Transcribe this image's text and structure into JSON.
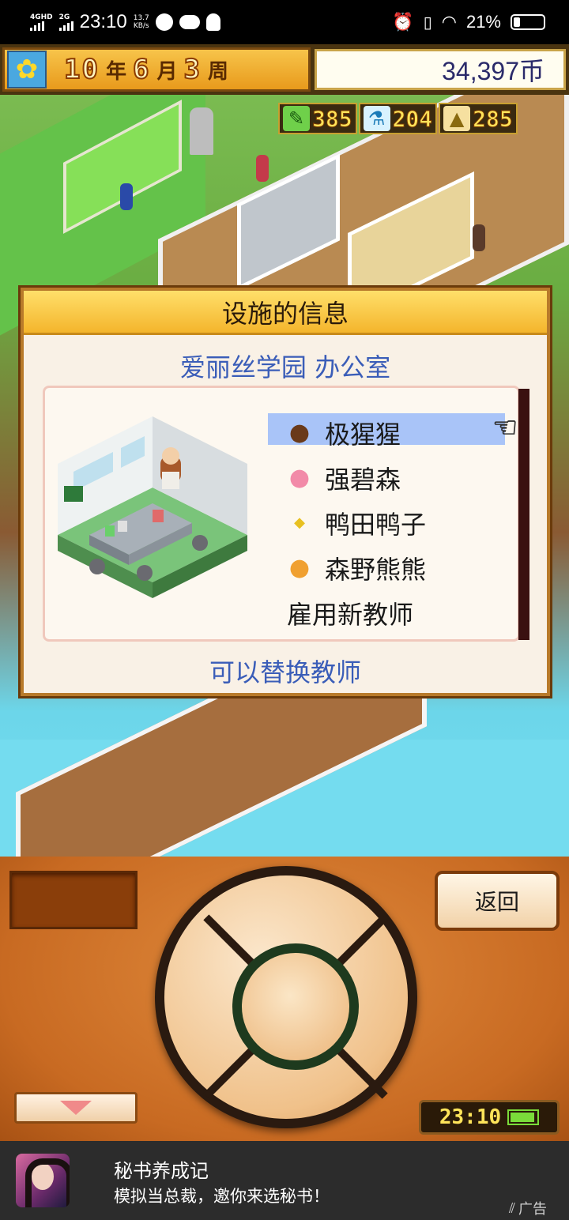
{
  "status_bar": {
    "network_1": "4GHD",
    "network_2": "2G",
    "time": "23:10",
    "speed_value": "13.7",
    "speed_unit": "KB/s",
    "battery_percent": "21%"
  },
  "hud": {
    "year": "10",
    "year_unit": "年",
    "month": "6",
    "month_unit": "月",
    "week": "3",
    "week_unit": "周",
    "money": "34,397币",
    "stats": [
      {
        "icon": "pencil-icon",
        "value": "385",
        "color": "#6fd04a"
      },
      {
        "icon": "flask-icon",
        "value": "204",
        "color": "#4ac3e8"
      },
      {
        "icon": "pyramid-icon",
        "value": "285",
        "color": "#e8c04a"
      }
    ]
  },
  "dialog": {
    "title": "设施的信息",
    "subtitle": "爱丽丝学园 办公室",
    "teachers": [
      {
        "name": "极猩猩",
        "icon": "gorilla-icon",
        "selected": true
      },
      {
        "name": "强碧森",
        "icon": "rabbit-icon",
        "selected": false
      },
      {
        "name": "鸭田鸭子",
        "icon": "duck-icon",
        "selected": false
      },
      {
        "name": "森野熊熊",
        "icon": "bear-icon",
        "selected": false
      }
    ],
    "hire_label": "雇用新教师",
    "footer": "可以替换教师"
  },
  "controller": {
    "back_label": "返回",
    "clock": "23:10"
  },
  "ad": {
    "title": "秘书养成记",
    "description": "模拟当总裁，邀你来选秘书！",
    "tag": "广告"
  }
}
